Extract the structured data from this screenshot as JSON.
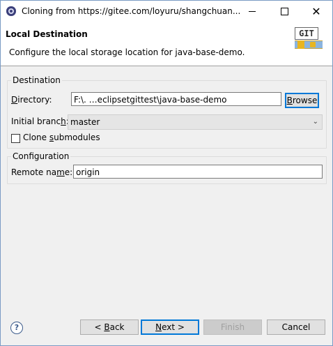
{
  "window": {
    "title": "Cloning from https://gitee.com/loyuru/shangchuan..."
  },
  "header": {
    "title": "Local Destination",
    "description": "Configure the local storage location for java-base-demo.",
    "logo_text": "GIT",
    "logo_icon": "git-logo-icon"
  },
  "destination": {
    "group_title": "Destination",
    "directory_label": "Directory:",
    "directory_value": "F:\\.      …eclipsetgittest\\java-base-demo",
    "browse_label": "Browse",
    "initial_branch_label": "Initial branch:",
    "initial_branch_value": "master",
    "clone_submodules_label": "Clone submodules",
    "clone_submodules_checked": false
  },
  "configuration": {
    "group_title": "Configuration",
    "remote_name_label": "Remote name:",
    "remote_name_value": "origin"
  },
  "footer": {
    "back_label": "< Back",
    "next_label": "Next >",
    "finish_label": "Finish",
    "cancel_label": "Cancel"
  },
  "colors": {
    "accent": "#0078d7",
    "header_bg": "#ffffff",
    "dialog_bg": "#f0f0f0"
  }
}
